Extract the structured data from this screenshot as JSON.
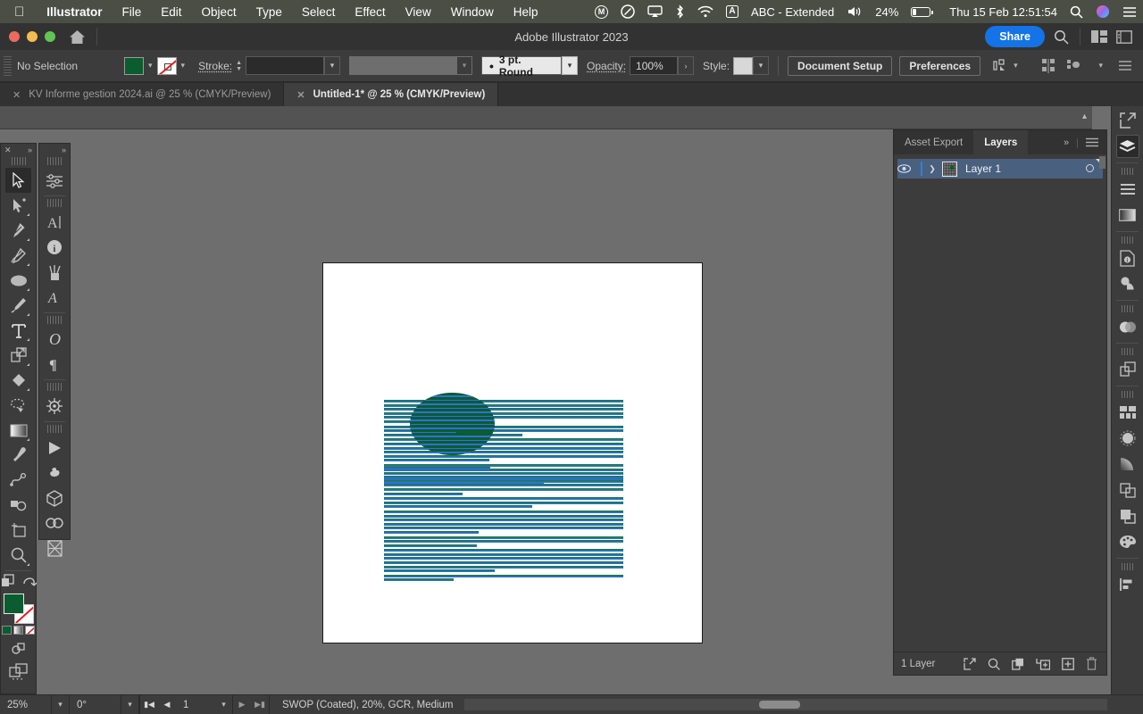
{
  "menubar": {
    "apple_icon": "apple-icon",
    "items": [
      {
        "label": "Illustrator",
        "bold": true
      },
      {
        "label": "File",
        "bold": false
      },
      {
        "label": "Edit",
        "bold": false
      },
      {
        "label": "Object",
        "bold": false
      },
      {
        "label": "Type",
        "bold": false
      },
      {
        "label": "Select",
        "bold": false
      },
      {
        "label": "Effect",
        "bold": false
      },
      {
        "label": "View",
        "bold": false
      },
      {
        "label": "Window",
        "bold": false
      },
      {
        "label": "Help",
        "bold": false
      }
    ],
    "status_icons": [
      "monterey-icon",
      "dropbox-icon",
      "airplay-icon",
      "bluetooth-icon",
      "wifi-icon"
    ],
    "input_source": "ABC - Extended",
    "battery_percent": "24%",
    "datetime": "Thu 15 Feb 12:51:54",
    "right_icons": [
      "search-icon",
      "siri-icon",
      "control-center-icon"
    ]
  },
  "titlebar": {
    "title": "Adobe Illustrator 2023",
    "home_icon": "home-icon",
    "share_label": "Share",
    "search_icon": "search-icon",
    "arrange_icon": "arrange-documents-icon",
    "workspace_icon": "workspace-switcher-icon"
  },
  "controlbar": {
    "selection_state": "No Selection",
    "fill_color": "#0b5c2f",
    "fill_label": "fill-swatch",
    "stroke_color": "none",
    "stroke_label": "Stroke:",
    "stroke_weight": "",
    "stroke_profile": "",
    "stroke_style": "3 pt. Round",
    "opacity_label": "Opacity:",
    "opacity_value": "100%",
    "style_label": "Style:",
    "style_swatch": "#d8d8d8",
    "document_setup": "Document Setup",
    "preferences": "Preferences",
    "align_icon": "align-to-selection-icon"
  },
  "document_tabs": [
    {
      "title": "KV Informe gestion 2024.ai @ 25 % (CMYK/Preview)",
      "active": false
    },
    {
      "title": "Untitled-1* @ 25 % (CMYK/Preview)",
      "active": true
    }
  ],
  "tools_primary": [
    {
      "name": "selection-tool",
      "glyph": "arrow",
      "selected": true,
      "has_flyout": false
    },
    {
      "name": "direct-selection-tool",
      "glyph": "arrow-plus",
      "selected": false,
      "has_flyout": true
    },
    {
      "name": "pen-tool",
      "glyph": "pen",
      "selected": false,
      "has_flyout": true
    },
    {
      "name": "curvature-tool",
      "glyph": "curvature",
      "selected": false,
      "has_flyout": false
    },
    {
      "name": "ellipse-tool",
      "glyph": "ellipse",
      "selected": false,
      "has_flyout": true
    },
    {
      "name": "paintbrush-tool",
      "glyph": "brush",
      "selected": false,
      "has_flyout": true
    },
    {
      "name": "type-tool",
      "glyph": "type",
      "selected": false,
      "has_flyout": true
    },
    {
      "name": "free-transform-tool",
      "glyph": "transform",
      "selected": false,
      "has_flyout": true
    },
    {
      "name": "shape-builder-tool",
      "glyph": "diamond",
      "selected": false,
      "has_flyout": true
    },
    {
      "name": "lasso-tool",
      "glyph": "lasso",
      "selected": false,
      "has_flyout": false
    },
    {
      "name": "gradient-tool",
      "glyph": "gradient",
      "selected": false,
      "has_flyout": true
    },
    {
      "name": "eyedropper-tool",
      "glyph": "eyedropper",
      "selected": false,
      "has_flyout": false
    },
    {
      "name": "blend-tool",
      "glyph": "blend",
      "selected": false,
      "has_flyout": false
    },
    {
      "name": "symbol-sprayer-tool",
      "glyph": "symbols",
      "selected": false,
      "has_flyout": false
    },
    {
      "name": "artboard-tool",
      "glyph": "artboard",
      "selected": false,
      "has_flyout": false
    },
    {
      "name": "zoom-tool",
      "glyph": "zoom",
      "selected": false,
      "has_flyout": true
    }
  ],
  "tools_secondary": [
    {
      "name": "properties-sliders-icon"
    },
    {
      "name": "text-cursor-icon"
    },
    {
      "name": "info-icon"
    },
    {
      "name": "paint-brushes-icon"
    },
    {
      "name": "glyphs-icon"
    },
    {
      "name": "opentype-icon"
    },
    {
      "name": "paragraph-icon"
    },
    {
      "name": "wheel-icon"
    },
    {
      "name": "play-icon"
    },
    {
      "name": "clover-icon"
    },
    {
      "name": "cube-icon"
    },
    {
      "name": "links-icon"
    },
    {
      "name": "separations-icon"
    }
  ],
  "panel": {
    "tabs": [
      {
        "label": "Asset Export",
        "active": false
      },
      {
        "label": "Layers",
        "active": true
      }
    ],
    "collapse_icon": "collapse-panel-icon",
    "menu_icon": "panel-menu-icon",
    "layers": [
      {
        "name": "Layer 1",
        "visible": true,
        "locked": false,
        "selected": true,
        "expand_icon": "chevron-right-icon",
        "target_icon": "target-circle-icon"
      }
    ],
    "footer_count": "1 Layer",
    "footer_icons": [
      "locate-object-icon",
      "search-layers-icon",
      "collect-for-export-icon",
      "create-sublayer-icon",
      "create-new-layer-icon",
      "delete-selection-icon"
    ]
  },
  "dock_icons": [
    {
      "name": "export-icon",
      "selected": false
    },
    {
      "name": "layers-dock-icon",
      "selected": true
    },
    {
      "name": "libraries-icon",
      "selected": false
    },
    {
      "name": "gradient-dock-icon",
      "selected": false
    },
    {
      "name": "document-info-icon",
      "selected": false
    },
    {
      "name": "pathfinder-icon",
      "selected": false
    },
    {
      "name": "transparency-icon",
      "selected": false
    },
    {
      "name": "transform-dock-icon",
      "selected": false
    },
    {
      "name": "swatches-icon",
      "selected": false
    },
    {
      "name": "brushes-dock-icon",
      "selected": false
    },
    {
      "name": "gradient-panel-icon",
      "selected": false
    },
    {
      "name": "appearance-icon",
      "selected": false
    },
    {
      "name": "symbols-dock-icon",
      "selected": false
    },
    {
      "name": "color-panel-icon",
      "selected": false
    },
    {
      "name": "align-dock-icon",
      "selected": false
    }
  ],
  "statusbar": {
    "zoom_level": "25%",
    "rotation": "0°",
    "page_number": "1",
    "profile_info": "SWOP (Coated), 20%, GCR, Medium",
    "first_page_icon": "first-page-icon",
    "prev_page_icon": "prev-page-icon",
    "next_page_icon": "next-page-icon",
    "last_page_icon": "last-page-icon"
  },
  "artboard": {
    "text_color": "#1d7a3e",
    "highlight_color": "#2f6fe0",
    "circle_color": "#0b5c2f",
    "paragraphs": [
      6,
      3,
      6,
      3,
      2
    ],
    "paragraphs_lower": [
      1,
      6,
      3,
      6,
      3,
      6,
      2
    ],
    "circle_lines": 15,
    "body_text": "Lorem ipsum dolor sit amet, consectetuer adipiscing elit, sed diam nonummy nibh euismod tincidunt ut laoreet dolore magna aliquam erat volutpat. Ut wisi enim ad minim veniam, quis nostrud exerci tation ullamcorper suscipit lobortis nisl ut aliquip ex ea commodo consequat. Duis autem vel eum iriure dolor in hendrerit in vulputate velit esse molestie consequat, vel illum dolore eu feugiat nulla facilisis at vero eros et accumsan et iusto odio dignissim qui blandit praesent luptatum zzril delenit augue duis dolore te feugait nulla facilisi."
  }
}
